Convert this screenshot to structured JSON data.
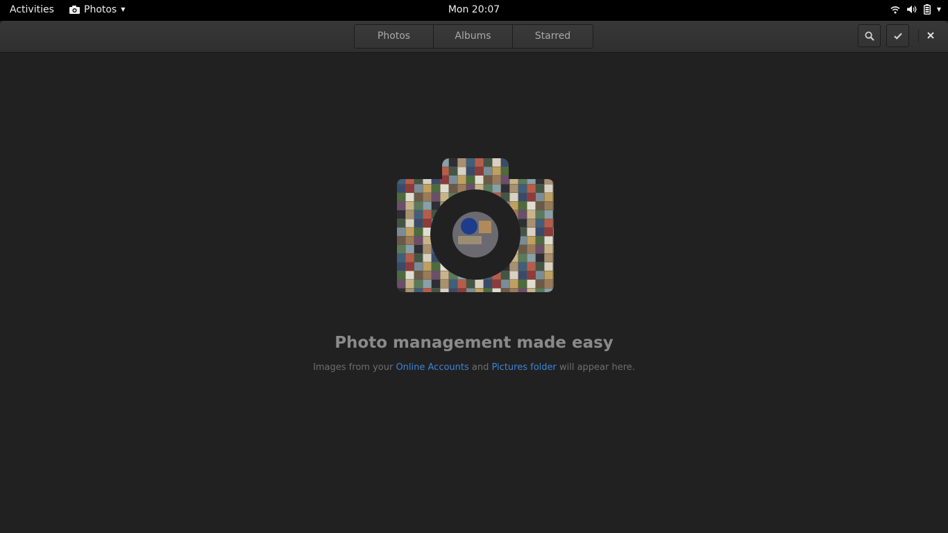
{
  "topbar": {
    "activities": "Activities",
    "app_name": "Photos",
    "clock": "Mon 20:07",
    "icons": [
      "camera-icon",
      "wifi-icon",
      "volume-icon",
      "battery-icon",
      "chevron-down-icon"
    ]
  },
  "header": {
    "tabs": [
      {
        "label": "Photos"
      },
      {
        "label": "Albums"
      },
      {
        "label": "Starred"
      }
    ],
    "buttons": [
      "search-icon",
      "checkmark-icon",
      "close-icon"
    ]
  },
  "empty_state": {
    "title": "Photo management made easy",
    "subtitle_pre": "Images from your ",
    "link_accounts": "Online Accounts",
    "subtitle_mid": " and ",
    "link_pictures": "Pictures folder",
    "subtitle_post": " will appear here."
  },
  "colors": {
    "background": "#212121",
    "link": "#3d84d9",
    "topbar": "#000000"
  }
}
